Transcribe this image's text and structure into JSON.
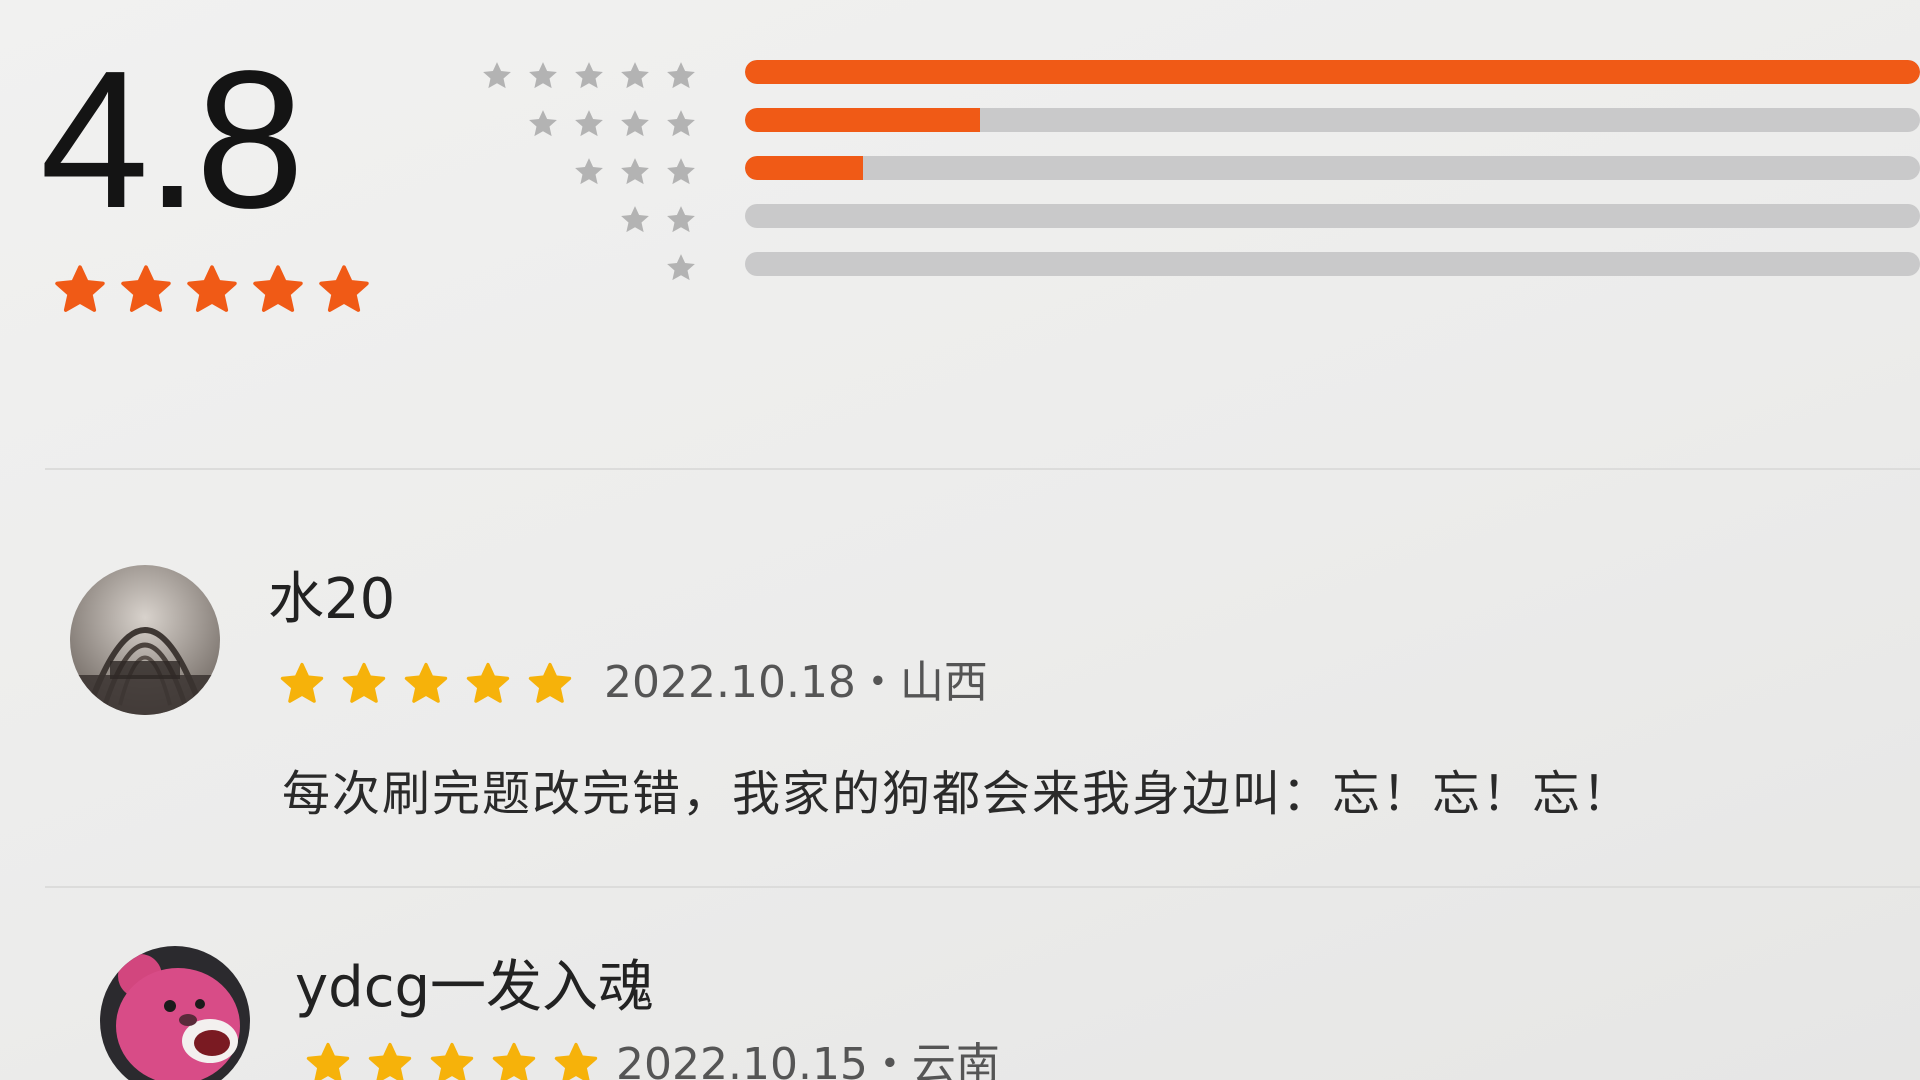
{
  "summary": {
    "score": "4.8",
    "score_stars": 5,
    "accent_color": "#f05a16",
    "distribution": [
      {
        "stars": 5,
        "fraction": 1.0
      },
      {
        "stars": 4,
        "fraction": 0.2
      },
      {
        "stars": 3,
        "fraction": 0.1
      },
      {
        "stars": 2,
        "fraction": 0.0
      },
      {
        "stars": 1,
        "fraction": 0.0
      }
    ]
  },
  "reviews": [
    {
      "name": "水20",
      "stars": 5,
      "meta": "2022.10.18・山西",
      "text": "每次刷完题改完错，我家的狗都会来我身边叫：忘！忘！忘！",
      "avatar_icon": "bridge-arch-avatar"
    },
    {
      "name": "ydcg一发入魂",
      "stars": 5,
      "meta": "2022.10.15・云南",
      "text": "",
      "avatar_icon": "pink-bear-avatar"
    }
  ],
  "star_color_review": "#f6b20a",
  "star_color_inactive": "#b3b3b3"
}
